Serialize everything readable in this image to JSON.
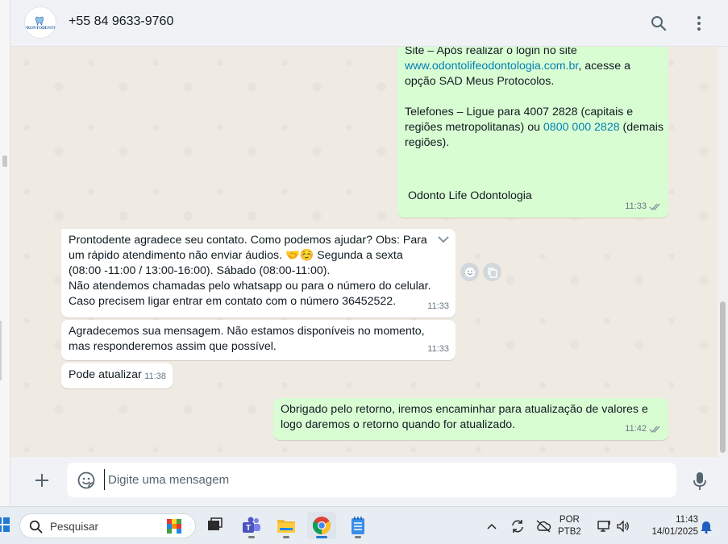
{
  "header": {
    "contact_name": "+55 84 9633-9760",
    "avatar_logo_text": "PRONTODENTE",
    "search_icon": "search-icon",
    "menu_icon": "kebab-menu-icon"
  },
  "messages": [
    {
      "direction": "out",
      "lines": [
        "Site – Após realizar o login no site",
        "www.odontolifeodontologia.com.br",
        ", acesse a opção SAD Meus Protocolos.",
        "Telefones – Ligue para 4007 2828 (capitais e regiões metropolitanas) ou ",
        "0800 000 2828",
        " (demais regiões)."
      ],
      "signature": "Odonto Life Odontologia",
      "time": "11:33",
      "status": "read"
    },
    {
      "direction": "in",
      "text": "Prontodente agradece seu contato. Como podemos ajudar? Obs: Para um rápido atendimento não enviar áudios. 🤝☺️ Segunda a sexta (08:00 -11:00 / 13:00-16:00). Sábado (08:00-11:00).\nNão atendemos chamadas pelo whatsapp ou para o número do celular. Caso precisem ligar entrar em contato com o número 36452522.",
      "time": "11:33"
    },
    {
      "direction": "in",
      "text": "Agradecemos sua mensagem. Não estamos disponíveis no momento, mas responderemos assim que possível.",
      "time": "11:33"
    },
    {
      "direction": "in",
      "text": "Pode atualizar",
      "time": "11:38"
    },
    {
      "direction": "out",
      "text": "Obrigado pelo retorno, iremos encaminhar para atualização de valores e logo daremos o retorno quando for atualizado.",
      "time": "11:42",
      "status": "read"
    }
  ],
  "composer": {
    "placeholder": "Digite uma mensagem"
  },
  "taskbar": {
    "search_label": "Pesquisar",
    "lang_line1": "POR",
    "lang_line2": "PTB2",
    "time": "11:43",
    "date": "14/01/2025"
  },
  "colors": {
    "outgoing_bubble": "#d9fdd3",
    "incoming_bubble": "#ffffff",
    "chat_background": "#efeae2",
    "link": "#027eb5",
    "read_ticks": "#8696a0"
  }
}
